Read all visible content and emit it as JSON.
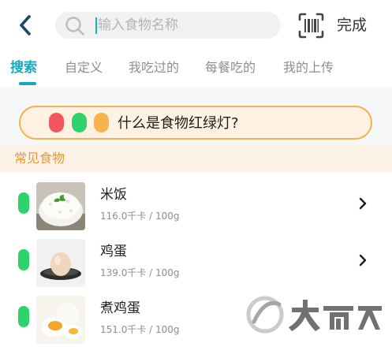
{
  "header": {
    "search_placeholder": "输入食物名称",
    "done_label": "完成"
  },
  "tabs": [
    {
      "label": "搜索",
      "active": true
    },
    {
      "label": "自定义",
      "active": false
    },
    {
      "label": "我吃过的",
      "active": false
    },
    {
      "label": "每餐吃的",
      "active": false
    },
    {
      "label": "我的上传",
      "active": false
    }
  ],
  "banner": {
    "text": "什么是食物红绿灯?",
    "colors": [
      "#f1565f",
      "#2ed36d",
      "#f9b24c"
    ]
  },
  "section": {
    "title": "常见食物"
  },
  "foods": [
    {
      "name": "米饭",
      "calories": "116.0千卡 / 100g",
      "light": "green",
      "icon": "rice-bowl-icon"
    },
    {
      "name": "鸡蛋",
      "calories": "139.0千卡 / 100g",
      "light": "green",
      "icon": "egg-icon"
    },
    {
      "name": "煮鸡蛋",
      "calories": "151.0千卡 / 100g",
      "light": "green",
      "icon": "boiled-egg-icon"
    }
  ],
  "colors": {
    "accent": "#16a9bb",
    "green_light": "#2fd36c",
    "section_text": "#e49a3c"
  }
}
